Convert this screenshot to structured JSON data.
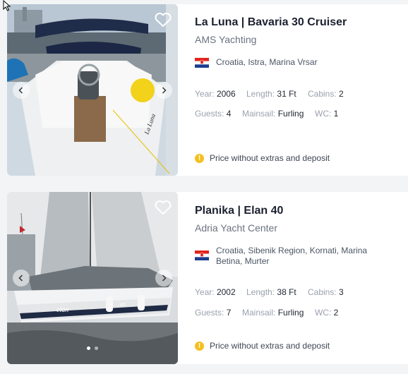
{
  "colors": {
    "accent_warning": "#f4c020",
    "title": "#1c2130",
    "muted": "#9aa1ad"
  },
  "listings": [
    {
      "title": "La Luna | Bavaria 30 Cruiser",
      "company": "AMS Yachting",
      "location": "Croatia, Istra, Marina Vrsar",
      "flag": "croatia-flag",
      "specs": {
        "year_label": "Year:",
        "year": "2006",
        "length_label": "Length:",
        "length": "31 Ft",
        "cabins_label": "Cabins:",
        "cabins": "2",
        "guests_label": "Guests:",
        "guests": "4",
        "mainsail_label": "Mainsail:",
        "mainsail": "Furling",
        "wc_label": "WC:",
        "wc": "1"
      },
      "price_note": "Price without extras and deposit"
    },
    {
      "title": "Planika | Elan 40",
      "company": "Adria Yacht Center",
      "location": "Croatia, Sibenik Region, Kornati, Marina Betina, Murter",
      "flag": "croatia-flag",
      "specs": {
        "year_label": "Year:",
        "year": "2002",
        "length_label": "Length:",
        "length": "38 Ft",
        "cabins_label": "Cabins:",
        "cabins": "3",
        "guests_label": "Guests:",
        "guests": "7",
        "mainsail_label": "Mainsail:",
        "mainsail": "Furling",
        "wc_label": "WC:",
        "wc": "2"
      },
      "price_note": "Price without extras and deposit"
    }
  ],
  "photo_text": {
    "boat1_hull_name": "La Luna",
    "boat2_hull_brand": "elan",
    "boat2_hull_model": "40"
  },
  "icons": {
    "info": "!",
    "favorite": "heart-icon",
    "prev": "chevron-left-icon",
    "next": "chevron-right-icon"
  }
}
